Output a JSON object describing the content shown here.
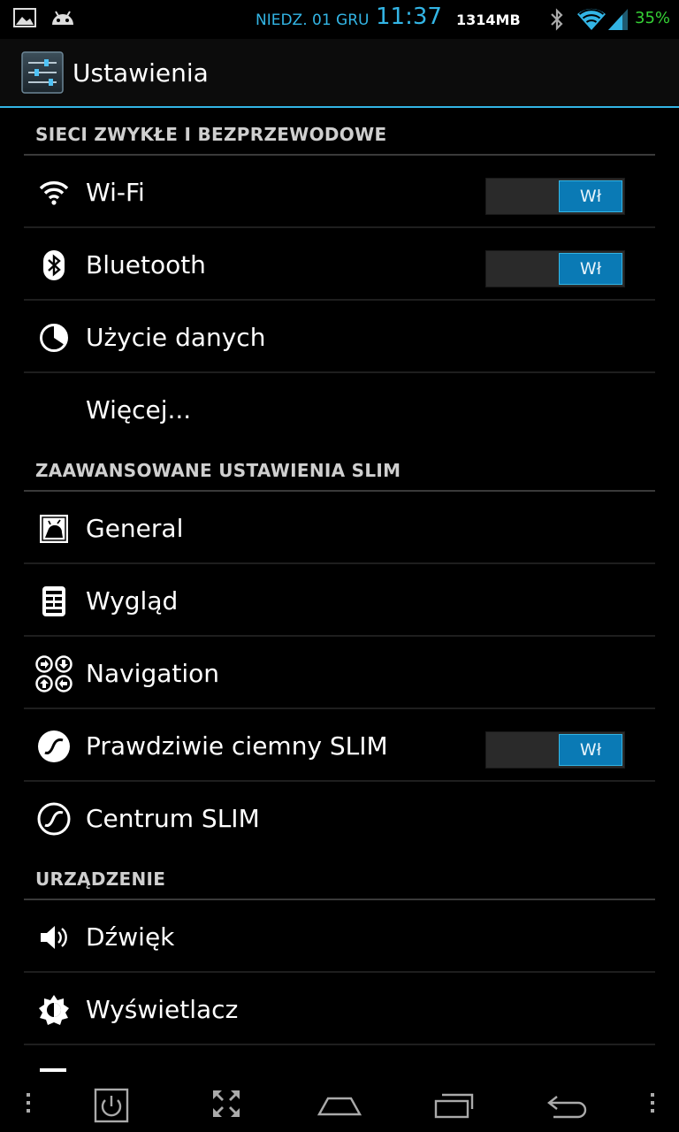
{
  "statusbar": {
    "date": "NIEDZ. 01 GRU",
    "time": "11:37",
    "memory": "1314MB",
    "battery": "35%"
  },
  "actionbar": {
    "title": "Ustawienia"
  },
  "sections": {
    "wireless": {
      "header": "SIECI ZWYKŁE I BEZPRZEWODOWE",
      "wifi": {
        "label": "Wi-Fi",
        "toggle": "Wł"
      },
      "bluetooth": {
        "label": "Bluetooth",
        "toggle": "Wł"
      },
      "data_usage": {
        "label": "Użycie danych"
      },
      "more": {
        "label": "Więcej..."
      }
    },
    "slim": {
      "header": "ZAAWANSOWANE USTAWIENIA SLIM",
      "general": {
        "label": "General"
      },
      "appearance": {
        "label": "Wygląd"
      },
      "navigation": {
        "label": "Navigation"
      },
      "dark": {
        "label": "Prawdziwie ciemny SLIM",
        "toggle": "Wł"
      },
      "center": {
        "label": "Centrum SLIM"
      }
    },
    "device": {
      "header": "URZĄDZENIE",
      "sound": {
        "label": "Dźwięk"
      },
      "display": {
        "label": "Wyświetlacz"
      }
    }
  },
  "colors": {
    "accent": "#33b5e5",
    "battery": "#35d135",
    "toggle_on": "#0a7ab5"
  }
}
